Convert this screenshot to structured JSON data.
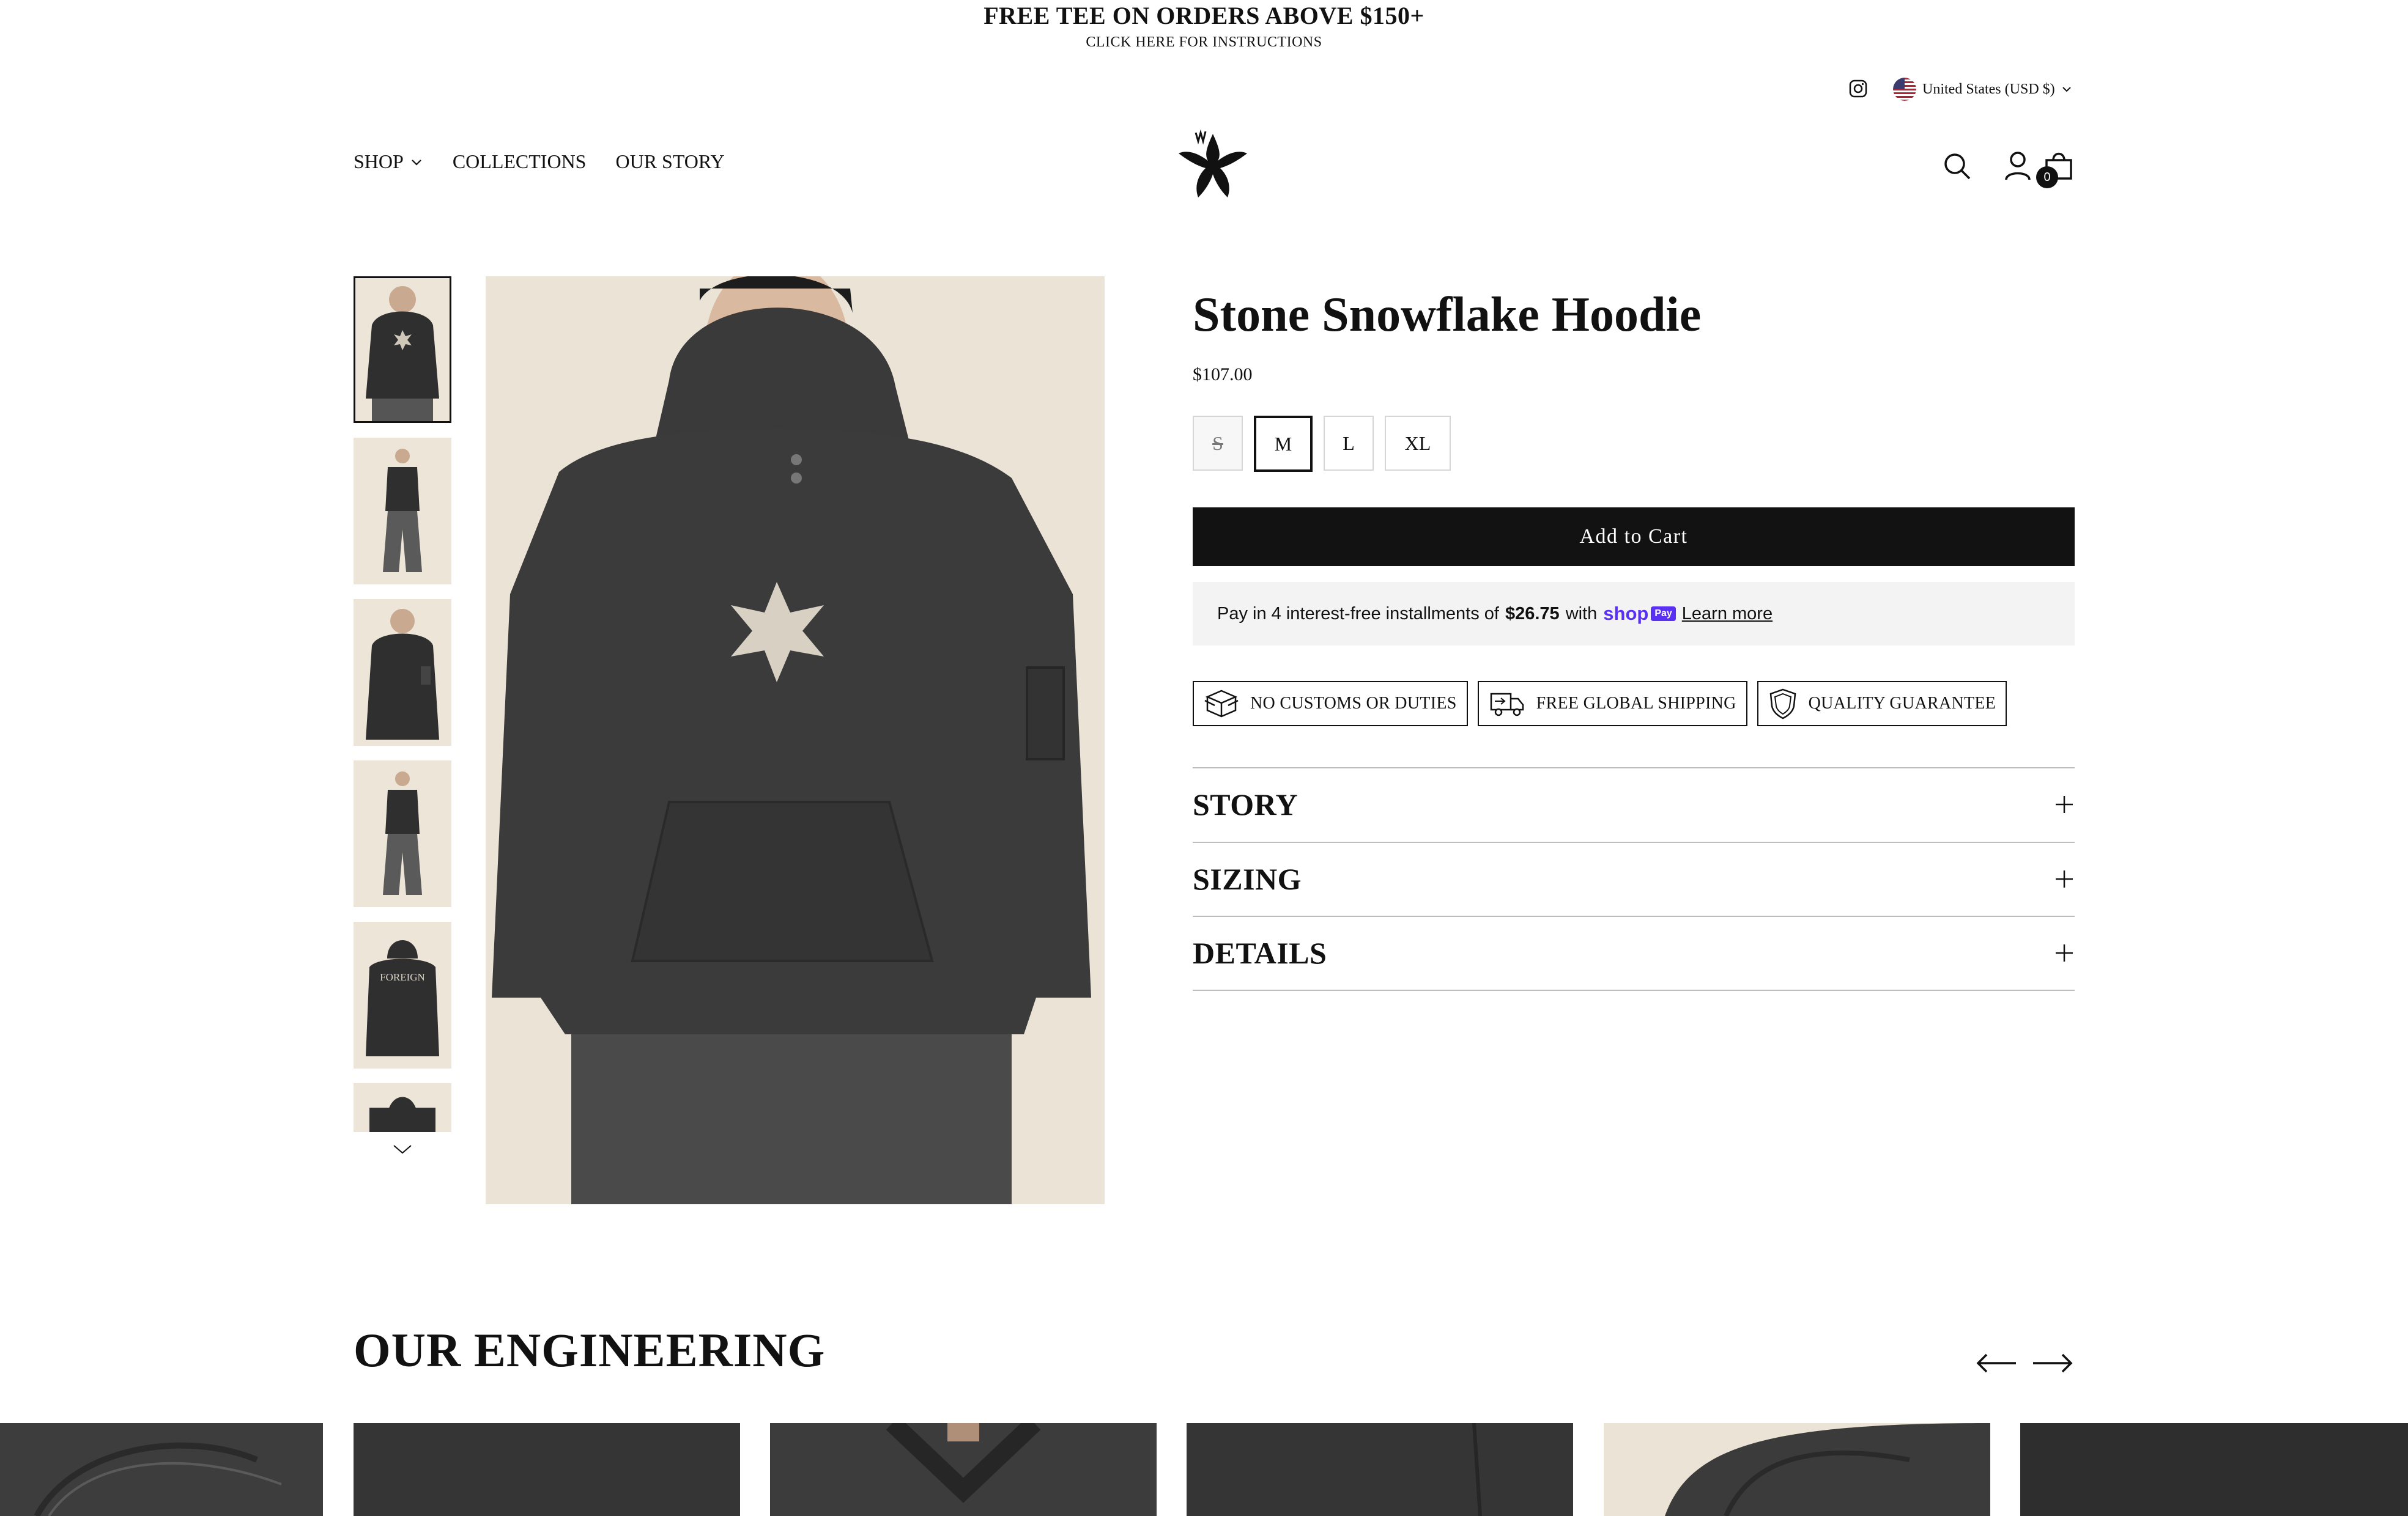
{
  "announcement": {
    "title": "FREE TEE ON ORDERS ABOVE $150+",
    "subtitle": "CLICK HERE FOR INSTRUCTIONS"
  },
  "utility": {
    "locale": "United States (USD $)"
  },
  "nav": {
    "items": [
      {
        "label": "SHOP",
        "has_dropdown": true
      },
      {
        "label": "COLLECTIONS"
      },
      {
        "label": "OUR STORY"
      }
    ],
    "cart_count": "0"
  },
  "product": {
    "title": "Stone Snowflake Hoodie",
    "price": "$107.00",
    "sizes": [
      {
        "label": "S",
        "state": "sold-out"
      },
      {
        "label": "M",
        "state": "selected"
      },
      {
        "label": "L",
        "state": "available"
      },
      {
        "label": "XL",
        "state": "available"
      }
    ],
    "add_to_cart": "Add to Cart",
    "shop_pay": {
      "prefix": "Pay in 4 interest-free installments of",
      "amount": "$26.75",
      "with": "with",
      "brand": "shop",
      "brand_pill": "Pay",
      "learn_more": "Learn more"
    },
    "badges": [
      {
        "label": "NO CUSTOMS OR DUTIES",
        "icon": "box-icon"
      },
      {
        "label": "FREE GLOBAL SHIPPING",
        "icon": "truck-icon"
      },
      {
        "label": "QUALITY GUARANTEE",
        "icon": "shield-icon"
      }
    ],
    "accordions": [
      {
        "label": "STORY"
      },
      {
        "label": "SIZING"
      },
      {
        "label": "DETAILS"
      }
    ]
  },
  "thumb_captions": {
    "back_print": "FOREIGN"
  },
  "engineering": {
    "title": "OUR ENGINEERING"
  },
  "colors": {
    "accent": "#121212",
    "shop_pay": "#5a31f4",
    "image_bg": "#ebe3d5",
    "fabric": "#3b3b3b"
  }
}
